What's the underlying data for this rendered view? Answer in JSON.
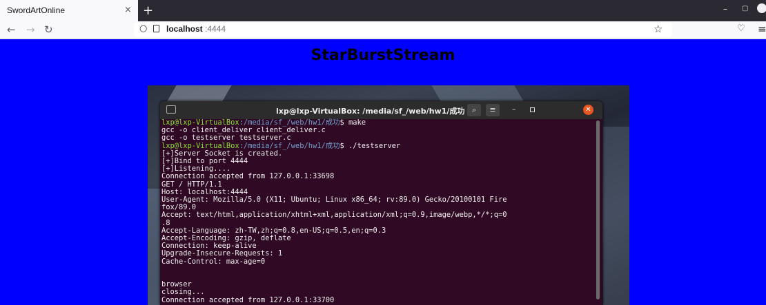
{
  "browser": {
    "tab_title": "SwordArtOnline",
    "tab_close": "×",
    "new_tab": "+",
    "url_host": "localhost",
    "url_port": ":4444"
  },
  "page": {
    "title": "StarBurstStream"
  },
  "terminal": {
    "title": "lxp@lxp-VirtualBox: /media/sf_/web/hw1/成功",
    "prompt_user": "lxp@lxp-VirtualBox",
    "prompt_path": ":/media/sf_/web/hw1/成功",
    "lines": [
      {
        "type": "prompt",
        "cmd": "$ make"
      },
      {
        "type": "out",
        "text": "gcc -o client_deliver client_deliver.c"
      },
      {
        "type": "out",
        "text": "gcc -o testserver testserver.c"
      },
      {
        "type": "prompt",
        "cmd": "$ ./testserver"
      },
      {
        "type": "out",
        "text": "[+]Server Socket is created."
      },
      {
        "type": "out",
        "text": "[+]Bind to port 4444"
      },
      {
        "type": "out",
        "text": "[+]Listening...."
      },
      {
        "type": "out",
        "text": "Connection accepted from 127.0.0.1:33698"
      },
      {
        "type": "out",
        "text": "GET / HTTP/1.1"
      },
      {
        "type": "out",
        "text": "Host: localhost:4444"
      },
      {
        "type": "out",
        "text": "User-Agent: Mozilla/5.0 (X11; Ubuntu; Linux x86_64; rv:89.0) Gecko/20100101 Fire"
      },
      {
        "type": "out",
        "text": "fox/89.0"
      },
      {
        "type": "out",
        "text": "Accept: text/html,application/xhtml+xml,application/xml;q=0.9,image/webp,*/*;q=0"
      },
      {
        "type": "out",
        "text": ".8"
      },
      {
        "type": "out",
        "text": "Accept-Language: zh-TW,zh;q=0.8,en-US;q=0.5,en;q=0.3"
      },
      {
        "type": "out",
        "text": "Accept-Encoding: gzip, deflate"
      },
      {
        "type": "out",
        "text": "Connection: keep-alive"
      },
      {
        "type": "out",
        "text": "Upgrade-Insecure-Requests: 1"
      },
      {
        "type": "out",
        "text": "Cache-Control: max-age=0"
      },
      {
        "type": "out",
        "text": ""
      },
      {
        "type": "out",
        "text": ""
      },
      {
        "type": "out",
        "text": "browser"
      },
      {
        "type": "out",
        "text": "closing..."
      },
      {
        "type": "out",
        "text": "Connection accepted from 127.0.0.1:33700"
      }
    ]
  }
}
